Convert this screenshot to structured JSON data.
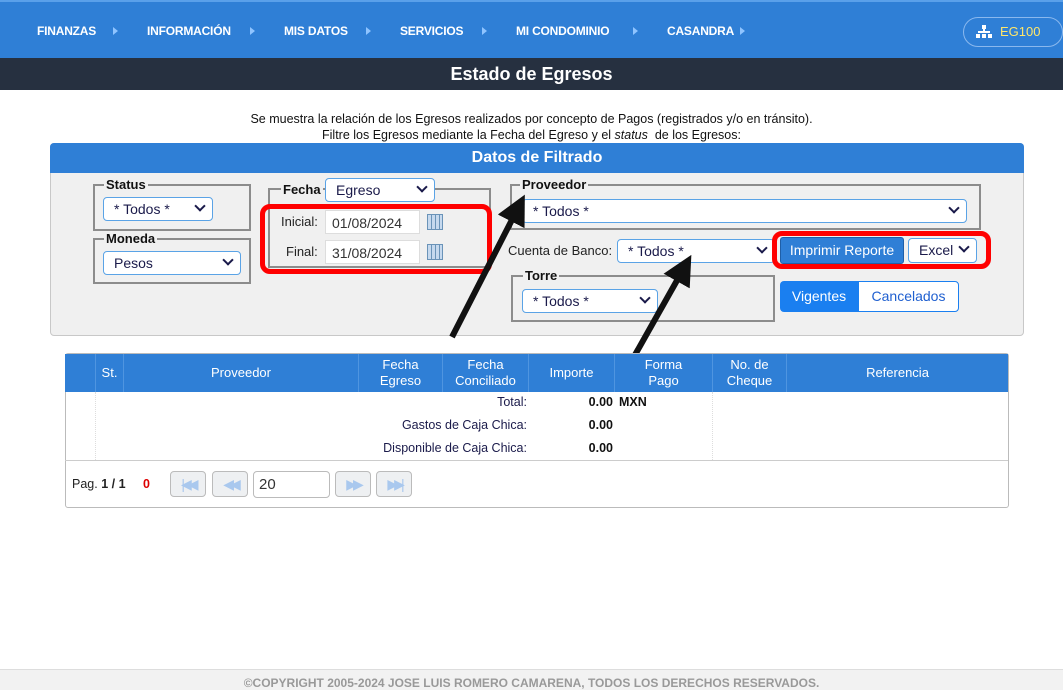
{
  "nav": {
    "items": [
      "FINANZAS",
      "INFORMACIÓN",
      "MIS DATOS",
      "SERVICIOS",
      "MI CONDOMINIO",
      "CASANDRA"
    ],
    "user": "EG100",
    "user_icon": "org-chart-icon"
  },
  "title": "Estado de Egresos",
  "intro": {
    "line1": "Se muestra la relación de los Egresos realizados por concepto de Pagos (registrados y/o en tránsito).",
    "line2_a": "Filtre los Egresos mediante la Fecha del Egreso y el ",
    "line2_em": "status",
    "line2_b": "  de los Egresos:"
  },
  "filter": {
    "heading": "Datos de Filtrado",
    "status": {
      "legend": "Status",
      "value": "* Todos *"
    },
    "moneda": {
      "legend": "Moneda",
      "value": "Pesos"
    },
    "fecha": {
      "legend": "Fecha",
      "type": "Egreso",
      "inicial_label": "Inicial:",
      "inicial": "01/08/2024",
      "final_label": "Final:",
      "final": "31/08/2024"
    },
    "proveedor": {
      "legend": "Proveedor",
      "value": "* Todos *"
    },
    "cuenta": {
      "label": "Cuenta de Banco:",
      "value": "* Todos *"
    },
    "torre": {
      "legend": "Torre",
      "value": "* Todos *"
    },
    "print_label": "Imprimir Reporte",
    "format": "Excel",
    "toggle": {
      "active": "Vigentes",
      "inactive": "Cancelados"
    }
  },
  "table": {
    "headers": [
      "St.",
      "Proveedor",
      "Fecha\nEgreso",
      "Fecha\nConciliado",
      "Importe",
      "Forma\nPago",
      "No. de\nCheque",
      "Referencia"
    ],
    "summary": [
      {
        "label": "Total:",
        "value": "0.00",
        "currency": "MXN"
      },
      {
        "label": "Gastos de Caja Chica:",
        "value": "0.00"
      },
      {
        "label": "Disponible de Caja Chica:",
        "value": "0.00"
      }
    ],
    "pager": {
      "prefix": "Pag.",
      "page": "1 / 1",
      "count": "0",
      "page_size": "20"
    }
  },
  "footer": "©COPYRIGHT 2005-2024 JOSE LUIS ROMERO CAMARENA, TODOS LOS DERECHOS RESERVADOS.",
  "colors": {
    "primary": "#2f7fd6",
    "titlebar": "#263040",
    "highlight": "#ff0000"
  }
}
